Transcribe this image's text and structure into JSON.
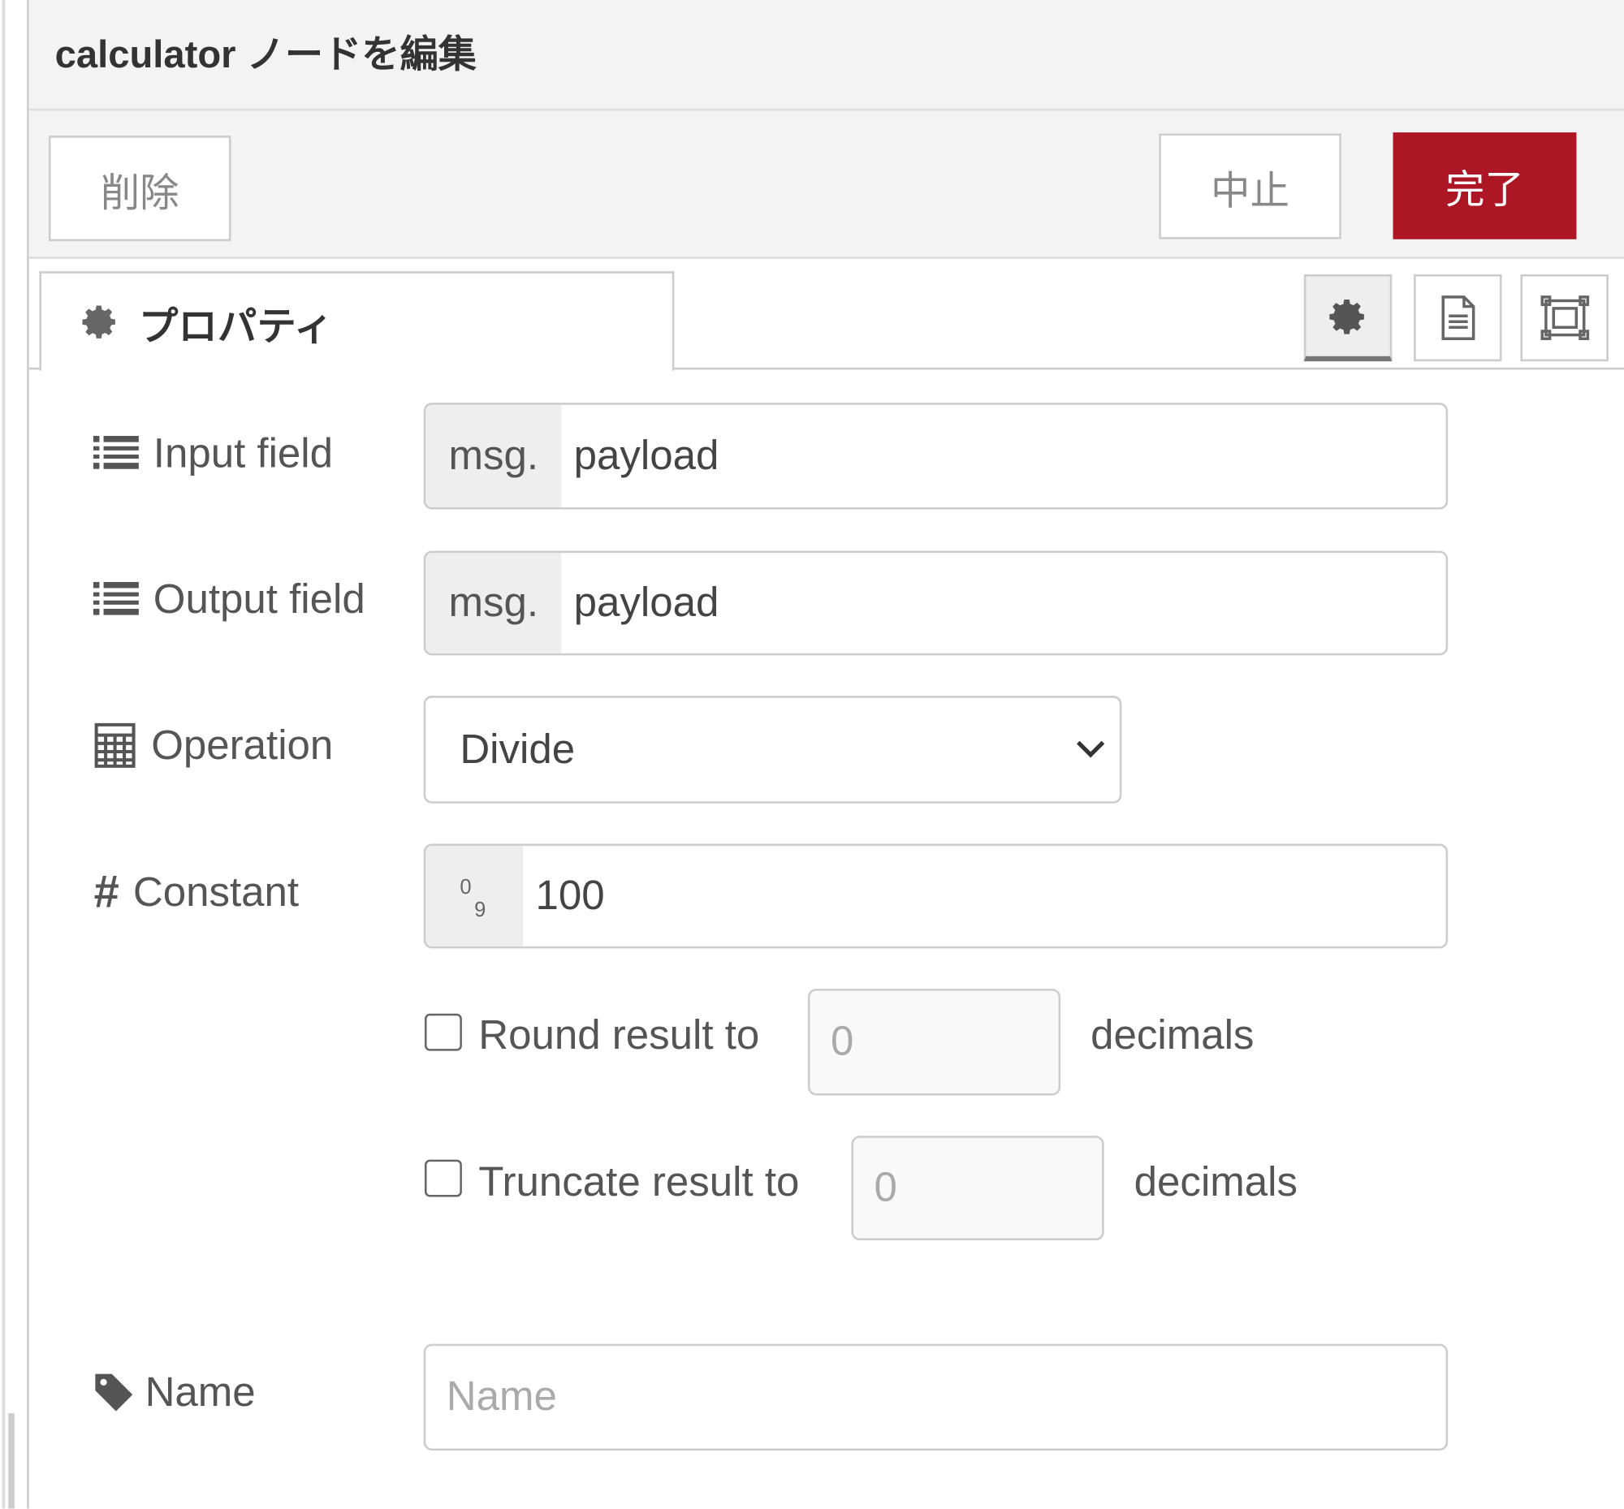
{
  "dialog": {
    "title": "calculator ノードを編集"
  },
  "buttons": {
    "delete": "削除",
    "cancel": "中止",
    "done": "完了"
  },
  "colors": {
    "primary": "#ad1625"
  },
  "tabs": {
    "properties": "プロパティ",
    "icons": [
      "gear-icon",
      "document-icon",
      "expand-icon"
    ]
  },
  "form": {
    "input_field": {
      "label": "Input field",
      "prefix": "msg.",
      "value": "payload"
    },
    "output_field": {
      "label": "Output field",
      "prefix": "msg.",
      "value": "payload"
    },
    "operation": {
      "label": "Operation",
      "value": "Divide"
    },
    "constant": {
      "label": "Constant",
      "value": "100"
    },
    "round": {
      "label": "Round result to",
      "checked": false,
      "value": "0",
      "suffix": "decimals"
    },
    "truncate": {
      "label": "Truncate result to",
      "checked": false,
      "value": "0",
      "suffix": "decimals"
    },
    "name": {
      "label": "Name",
      "placeholder": "Name",
      "value": ""
    }
  }
}
